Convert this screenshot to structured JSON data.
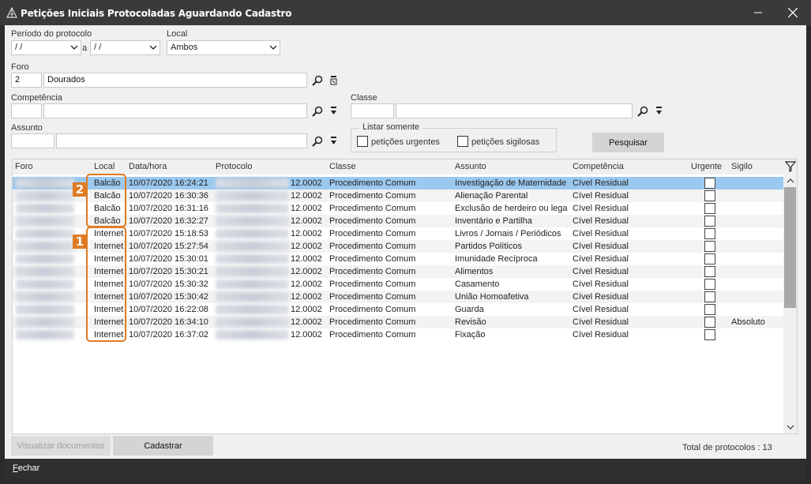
{
  "window": {
    "title": "Petições Iniciais Protocoladas Aguardando Cadastro"
  },
  "filters": {
    "periodo_label": "Período do protocolo",
    "date_from": " / /",
    "date_sep": "a",
    "date_to": " / /",
    "local_label": "Local",
    "local_value": "Ambos",
    "foro_label": "Foro",
    "foro_code": "2",
    "foro_name": "Dourados",
    "competencia_label": "Competência",
    "competencia_code": "",
    "competencia_name": "",
    "classe_label": "Classe",
    "classe_code": "",
    "classe_name": "",
    "assunto_label": "Assunto",
    "assunto_code": "",
    "assunto_name": "",
    "listar_label": "Listar somente",
    "urgentes_label": "petições urgentes",
    "sigilosas_label": "petições sigilosas",
    "pesquisar_label": "Pesquisar"
  },
  "grid": {
    "columns": {
      "foro": "Foro",
      "local": "Local",
      "datahora": "Data/hora",
      "protocolo": "Protocolo",
      "classe": "Classe",
      "assunto": "Assunto",
      "competencia": "Competência",
      "urgente": "Urgente",
      "sigilo": "Sigilo"
    },
    "rows": [
      {
        "local": "Balcão",
        "datahora": "10/07/2020 16:24:21",
        "protocolo": "12.0002",
        "classe": "Procedimento Comum",
        "assunto": "Investigação de Maternidade",
        "competencia": "Cível Residual",
        "sigilo": ""
      },
      {
        "local": "Balcão",
        "datahora": "10/07/2020 16:30:36",
        "protocolo": "12.0002",
        "classe": "Procedimento Comum",
        "assunto": "Alienação Parental",
        "competencia": "Cível Residual",
        "sigilo": ""
      },
      {
        "local": "Balcão",
        "datahora": "10/07/2020 16:31:16",
        "protocolo": "12.0002",
        "classe": "Procedimento Comum",
        "assunto": "Exclusão de herdeiro ou lega",
        "competencia": "Cível Residual",
        "sigilo": ""
      },
      {
        "local": "Balcão",
        "datahora": "10/07/2020 16:32:27",
        "protocolo": "12.0002",
        "classe": "Procedimento Comum",
        "assunto": "Inventário e Partilha",
        "competencia": "Cível Residual",
        "sigilo": ""
      },
      {
        "local": "Internet",
        "datahora": "10/07/2020 15:18:53",
        "protocolo": "12.0002",
        "classe": "Procedimento Comum",
        "assunto": "Livros / Jornais / Periódicos",
        "competencia": "Cível Residual",
        "sigilo": ""
      },
      {
        "local": "Internet",
        "datahora": "10/07/2020 15:27:54",
        "protocolo": "12.0002",
        "classe": "Procedimento Comum",
        "assunto": "Partidos Políticos",
        "competencia": "Cível Residual",
        "sigilo": ""
      },
      {
        "local": "Internet",
        "datahora": "10/07/2020 15:30:01",
        "protocolo": "12.0002",
        "classe": "Procedimento Comum",
        "assunto": "Imunidade Recíproca",
        "competencia": "Cível Residual",
        "sigilo": ""
      },
      {
        "local": "Internet",
        "datahora": "10/07/2020 15:30:21",
        "protocolo": "12.0002",
        "classe": "Procedimento Comum",
        "assunto": "Alimentos",
        "competencia": "Cível Residual",
        "sigilo": ""
      },
      {
        "local": "Internet",
        "datahora": "10/07/2020 15:30:32",
        "protocolo": "12.0002",
        "classe": "Procedimento Comum",
        "assunto": "Casamento",
        "competencia": "Cível Residual",
        "sigilo": ""
      },
      {
        "local": "Internet",
        "datahora": "10/07/2020 15:30:42",
        "protocolo": "12.0002",
        "classe": "Procedimento Comum",
        "assunto": "União Homoafetiva",
        "competencia": "Cível Residual",
        "sigilo": ""
      },
      {
        "local": "Internet",
        "datahora": "10/07/2020 16:22:08",
        "protocolo": "12.0002",
        "classe": "Procedimento Comum",
        "assunto": "Guarda",
        "competencia": "Cível Residual",
        "sigilo": ""
      },
      {
        "local": "Internet",
        "datahora": "10/07/2020 16:34:10",
        "protocolo": "12.0002",
        "classe": "Procedimento Comum",
        "assunto": "Revisão",
        "competencia": "Cível Residual",
        "sigilo": "Absoluto"
      },
      {
        "local": "Internet",
        "datahora": "10/07/2020 16:37:02",
        "protocolo": "12.0002",
        "classe": "Procedimento Comum",
        "assunto": "Fixação",
        "competencia": "Cível Residual",
        "sigilo": ""
      }
    ],
    "selected_row": 0
  },
  "markers": {
    "first": "1",
    "second": "2"
  },
  "actions": {
    "visualizar_label": "Visualizar documentos",
    "cadastrar_label": "Cadastrar",
    "total_label": "Total de protocolos : 13",
    "fechar_label": "Fechar"
  },
  "colors": {
    "accent_marker": "#e07b24",
    "selected_row": "#9bc8ee"
  }
}
